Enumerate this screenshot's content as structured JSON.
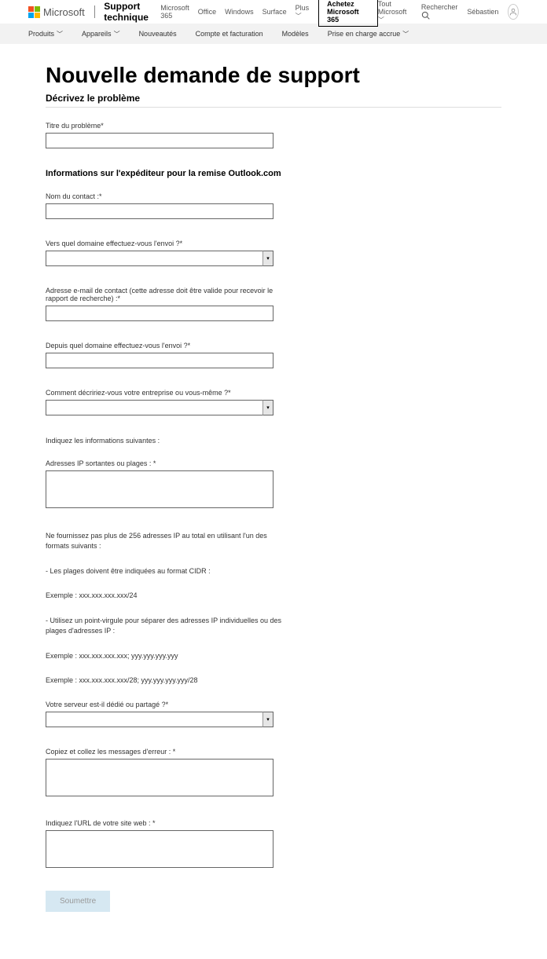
{
  "header": {
    "brand": "Microsoft",
    "site_title": "Support technique",
    "top_nav": [
      "Microsoft 365",
      "Office",
      "Windows",
      "Surface",
      "Plus"
    ],
    "cta": "Achetez Microsoft 365",
    "right": {
      "all_microsoft": "Tout Microsoft",
      "search": "Rechercher",
      "user": "Sébastien"
    }
  },
  "sub_nav": [
    "Produits",
    "Appareils",
    "Nouveautés",
    "Compte et facturation",
    "Modèles",
    "Prise en charge accrue"
  ],
  "page": {
    "title": "Nouvelle demande de support",
    "section1": "Décrivez le problème",
    "field_title": "Titre du problème*",
    "section2": "Informations sur l'expéditeur pour la remise Outlook.com",
    "contact_name": "Nom du contact :*",
    "to_domain": "Vers quel domaine effectuez-vous l'envoi ?*",
    "contact_email": "Adresse e-mail de contact (cette adresse doit être valide pour recevoir le rapport de recherche) :*",
    "from_domain": "Depuis quel domaine effectuez-vous l'envoi ?*",
    "describe_company": "Comment décririez-vous votre entreprise ou vous-même ?*",
    "info_following": "Indiquez les informations suivantes :",
    "ip_ranges": "Adresses IP sortantes ou plages : *",
    "no_more_256": "Ne fournissez pas plus de 256 adresses IP au total en utilisant l'un des formats suivants :",
    "cidr_note": "- Les plages doivent être indiquées au format CIDR :",
    "ex1": "Exemple : xxx.xxx.xxx.xxx/24",
    "semicolon_note": "- Utilisez un point-virgule pour séparer des adresses IP individuelles ou des plages d'adresses IP :",
    "ex2": "Exemple : xxx.xxx.xxx.xxx; yyy.yyy.yyy.yyy",
    "ex3": "Exemple : xxx.xxx.xxx.xxx/28; yyy.yyy.yyy.yyy/28",
    "server_shared": "Votre serveur est-il dédié ou partagé ?*",
    "error_msgs": "Copiez et collez les messages d'erreur : *",
    "website_url": "Indiquez l'URL de votre site web : *",
    "submit": "Soumettre"
  }
}
